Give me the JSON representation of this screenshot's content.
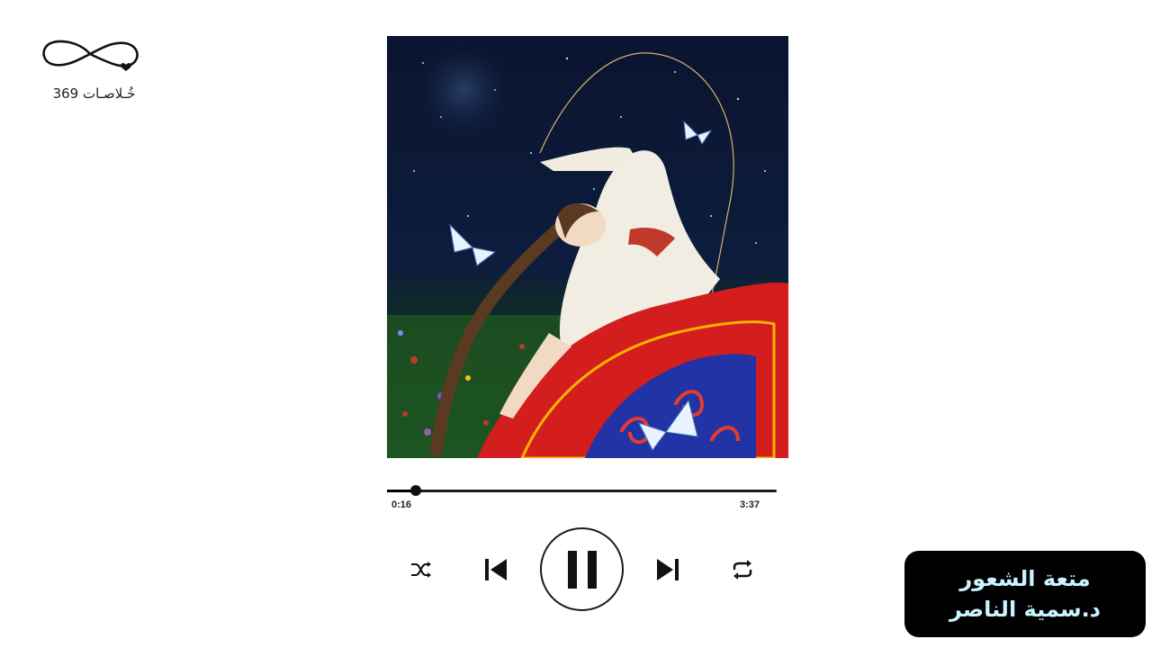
{
  "logo": {
    "text": "خُـلاصـات 369",
    "icon": "infinity-heart-icon"
  },
  "album": {
    "art": "illustration-woman-moon-butterflies"
  },
  "player": {
    "elapsed": "0:16",
    "total": "3:37",
    "progress_fraction": 0.074,
    "state": "playing"
  },
  "controls": {
    "shuffle_icon": "shuffle-icon",
    "previous_icon": "skip-previous-icon",
    "pause_icon": "pause-icon",
    "next_icon": "skip-next-icon",
    "repeat_icon": "repeat-icon"
  },
  "caption": {
    "title": "متعة الشعور",
    "author": "د.سمية الناصر"
  },
  "colors": {
    "caption_bg": "#000000",
    "caption_text": "#c9f3ff"
  }
}
